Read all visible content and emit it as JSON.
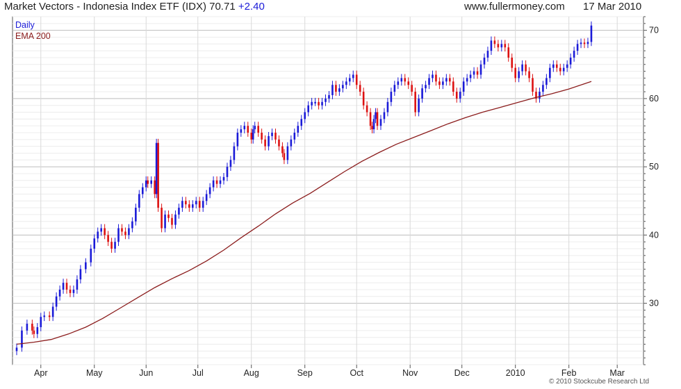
{
  "header": {
    "name": "Market Vectors - Indonesia Index ETF (IDX)",
    "last": "70.71",
    "change": "+2.40",
    "website": "www.fullermoney.com",
    "date": "17 Mar 2010"
  },
  "copyright": "© 2010 Stockcube Research Ltd",
  "colors": {
    "up": "#1a1ad8",
    "down": "#dd1111",
    "ema": "#8b1c1c",
    "grid": "#d9d9d9",
    "frame": "#555555"
  },
  "chart_data": {
    "type": "line",
    "ylim": [
      21,
      72
    ],
    "yticks": [
      30,
      40,
      50,
      60,
      70
    ],
    "xlim": [
      0,
      360
    ],
    "xticks": [
      {
        "label": "Apr",
        "x": 14
      },
      {
        "label": "May",
        "x": 45
      },
      {
        "label": "Jun",
        "x": 75
      },
      {
        "label": "Jul",
        "x": 105
      },
      {
        "label": "Aug",
        "x": 136
      },
      {
        "label": "Sep",
        "x": 167
      },
      {
        "label": "Oct",
        "x": 197
      },
      {
        "label": "Nov",
        "x": 228
      },
      {
        "label": "Dec",
        "x": 258
      },
      {
        "label": "2010",
        "x": 289
      },
      {
        "label": "Feb",
        "x": 320
      },
      {
        "label": "Mar",
        "x": 348
      }
    ],
    "grid": true,
    "legend": {
      "placement": "top-left",
      "entries": [
        {
          "name": "Daily",
          "color": "#1a1ad8"
        },
        {
          "name": "EMA 200",
          "color": "#8b1c1c"
        }
      ]
    },
    "series": [
      {
        "name": "Daily",
        "kind": "close",
        "points": [
          [
            0,
            23.5
          ],
          [
            3,
            26
          ],
          [
            6,
            27
          ],
          [
            9,
            26
          ],
          [
            10,
            25.5
          ],
          [
            12,
            26.5
          ],
          [
            14,
            28
          ],
          [
            16,
            28.2
          ],
          [
            19,
            28
          ],
          [
            21,
            29.5
          ],
          [
            23,
            31
          ],
          [
            25,
            32
          ],
          [
            27,
            33
          ],
          [
            29,
            32
          ],
          [
            31,
            31.5
          ],
          [
            33,
            32
          ],
          [
            35,
            33.5
          ],
          [
            37,
            35
          ],
          [
            40,
            36
          ],
          [
            43,
            38
          ],
          [
            45,
            39.5
          ],
          [
            47,
            40.5
          ],
          [
            49,
            41
          ],
          [
            51,
            40
          ],
          [
            53,
            39
          ],
          [
            55,
            38
          ],
          [
            57,
            39
          ],
          [
            59,
            41
          ],
          [
            61,
            40.5
          ],
          [
            63,
            40
          ],
          [
            65,
            41
          ],
          [
            67,
            42
          ],
          [
            69,
            44
          ],
          [
            71,
            46
          ],
          [
            73,
            47
          ],
          [
            75,
            48
          ],
          [
            76,
            47.5
          ],
          [
            78,
            48
          ],
          [
            80,
            46
          ],
          [
            81,
            53.5
          ],
          [
            82,
            44
          ],
          [
            84,
            41
          ],
          [
            86,
            43
          ],
          [
            88,
            42.5
          ],
          [
            90,
            41.5
          ],
          [
            92,
            43
          ],
          [
            94,
            44
          ],
          [
            96,
            45
          ],
          [
            98,
            44.5
          ],
          [
            100,
            44
          ],
          [
            102,
            44.5
          ],
          [
            104,
            45
          ],
          [
            106,
            44
          ],
          [
            108,
            45
          ],
          [
            110,
            46
          ],
          [
            112,
            47
          ],
          [
            114,
            48
          ],
          [
            116,
            47.5
          ],
          [
            118,
            48
          ],
          [
            120,
            48.5
          ],
          [
            122,
            50
          ],
          [
            124,
            51
          ],
          [
            126,
            53
          ],
          [
            128,
            55
          ],
          [
            130,
            55.5
          ],
          [
            132,
            56
          ],
          [
            134,
            55
          ],
          [
            136,
            54
          ],
          [
            137,
            55.5
          ],
          [
            138,
            56
          ],
          [
            140,
            55
          ],
          [
            142,
            54
          ],
          [
            144,
            53
          ],
          [
            146,
            54.5
          ],
          [
            148,
            55
          ],
          [
            150,
            54
          ],
          [
            152,
            53
          ],
          [
            154,
            52
          ],
          [
            155,
            51
          ],
          [
            157,
            53
          ],
          [
            159,
            54
          ],
          [
            161,
            55
          ],
          [
            163,
            56
          ],
          [
            165,
            57
          ],
          [
            167,
            58
          ],
          [
            169,
            59
          ],
          [
            171,
            59.5
          ],
          [
            173,
            59.5
          ],
          [
            175,
            59
          ],
          [
            177,
            59.5
          ],
          [
            179,
            60
          ],
          [
            181,
            60.5
          ],
          [
            183,
            62
          ],
          [
            185,
            61
          ],
          [
            187,
            61.5
          ],
          [
            189,
            62
          ],
          [
            191,
            62.5
          ],
          [
            193,
            63
          ],
          [
            195,
            63.5
          ],
          [
            197,
            62
          ],
          [
            199,
            61
          ],
          [
            201,
            59
          ],
          [
            203,
            58
          ],
          [
            205,
            56
          ],
          [
            206,
            55.5
          ],
          [
            207,
            57
          ],
          [
            208,
            58
          ],
          [
            209,
            56
          ],
          [
            211,
            57
          ],
          [
            213,
            58
          ],
          [
            215,
            59.5
          ],
          [
            217,
            61
          ],
          [
            219,
            62
          ],
          [
            221,
            62.5
          ],
          [
            223,
            63
          ],
          [
            225,
            62.5
          ],
          [
            227,
            62
          ],
          [
            229,
            61
          ],
          [
            231,
            58
          ],
          [
            233,
            60
          ],
          [
            235,
            61.5
          ],
          [
            237,
            62
          ],
          [
            239,
            63
          ],
          [
            241,
            63.5
          ],
          [
            243,
            62.5
          ],
          [
            245,
            62
          ],
          [
            247,
            62.5
          ],
          [
            249,
            63
          ],
          [
            251,
            62.5
          ],
          [
            253,
            61
          ],
          [
            255,
            60
          ],
          [
            257,
            61
          ],
          [
            259,
            62.5
          ],
          [
            261,
            63
          ],
          [
            263,
            63.5
          ],
          [
            265,
            64
          ],
          [
            267,
            63.5
          ],
          [
            269,
            65
          ],
          [
            271,
            66
          ],
          [
            273,
            67
          ],
          [
            275,
            68.5
          ],
          [
            277,
            68
          ],
          [
            279,
            67.5
          ],
          [
            281,
            68
          ],
          [
            283,
            67.5
          ],
          [
            285,
            66
          ],
          [
            287,
            64.5
          ],
          [
            289,
            63
          ],
          [
            291,
            64
          ],
          [
            293,
            65
          ],
          [
            295,
            64
          ],
          [
            297,
            63
          ],
          [
            299,
            61
          ],
          [
            301,
            60
          ],
          [
            303,
            61
          ],
          [
            305,
            62
          ],
          [
            307,
            63
          ],
          [
            309,
            64.5
          ],
          [
            311,
            65
          ],
          [
            313,
            64.5
          ],
          [
            315,
            64
          ],
          [
            317,
            64.5
          ],
          [
            319,
            65
          ],
          [
            321,
            66
          ],
          [
            323,
            67
          ],
          [
            325,
            68
          ],
          [
            327,
            68.2
          ],
          [
            329,
            68
          ],
          [
            331,
            68.3
          ],
          [
            333,
            70.7
          ]
        ]
      },
      {
        "name": "EMA 200",
        "points": [
          [
            0,
            24.0
          ],
          [
            10,
            24.3
          ],
          [
            20,
            24.7
          ],
          [
            30,
            25.5
          ],
          [
            40,
            26.5
          ],
          [
            50,
            27.8
          ],
          [
            60,
            29.3
          ],
          [
            70,
            30.8
          ],
          [
            80,
            32.3
          ],
          [
            90,
            33.6
          ],
          [
            100,
            34.8
          ],
          [
            110,
            36.2
          ],
          [
            120,
            37.8
          ],
          [
            130,
            39.6
          ],
          [
            140,
            41.3
          ],
          [
            150,
            43.1
          ],
          [
            160,
            44.7
          ],
          [
            170,
            46.1
          ],
          [
            180,
            47.7
          ],
          [
            190,
            49.3
          ],
          [
            200,
            50.8
          ],
          [
            210,
            52.1
          ],
          [
            220,
            53.3
          ],
          [
            230,
            54.3
          ],
          [
            240,
            55.3
          ],
          [
            250,
            56.3
          ],
          [
            260,
            57.2
          ],
          [
            270,
            58.0
          ],
          [
            280,
            58.7
          ],
          [
            290,
            59.4
          ],
          [
            300,
            60.1
          ],
          [
            310,
            60.7
          ],
          [
            320,
            61.4
          ],
          [
            333,
            62.5
          ]
        ]
      }
    ]
  }
}
